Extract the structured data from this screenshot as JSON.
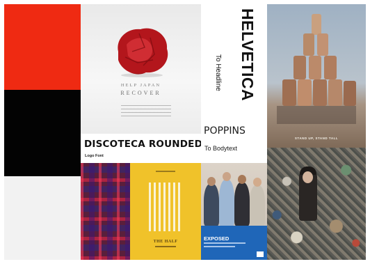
{
  "swatches": [
    {
      "name": "red",
      "color": "#ef2a12"
    },
    {
      "name": "black",
      "color": "#030303"
    },
    {
      "name": "light-gray",
      "color": "#f2f2f2"
    }
  ],
  "posters": {
    "japan": {
      "line1": "HELP JAPAN",
      "line2": "RECOVER"
    },
    "yellow": {
      "caption": "THE HALF"
    },
    "exposed": {
      "title": "EXPOSED"
    }
  },
  "fonts": {
    "logo": {
      "name": "DISCOTECA ROUNDED",
      "usage": "Logo Font"
    },
    "headline": {
      "name": "HELVETICA",
      "usage": "To Headline"
    },
    "body": {
      "name": "POPPINS",
      "usage": "To Bodytext"
    }
  },
  "photos": {
    "acrobats": {
      "caption": "STAND UP, STAND TALL",
      "icon": "human-pyramid-photo"
    },
    "clutter": {
      "icon": "clutter-collage-photo"
    }
  }
}
